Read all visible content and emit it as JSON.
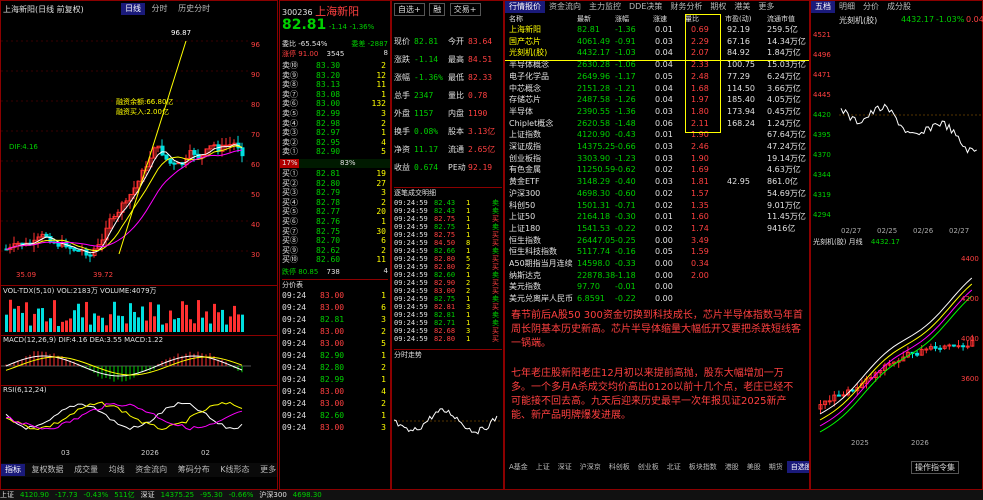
{
  "left_chart": {
    "title": "上海新阳(日线 前复权)",
    "tabs": [
      "日线",
      "分时",
      "历史分时"
    ],
    "price_axis": [
      "96",
      "90",
      "80",
      "70",
      "60",
      "50",
      "40",
      "30"
    ],
    "annotations": {
      "high": "96.87",
      "low1": "35.09",
      "low2": "39.72",
      "note1": "融资余额:66.80亿",
      "note2": "融资买入:2.00亿",
      "note3": "DIF:4.16"
    },
    "sub_titles": [
      "VOL-TDX(5,10) VOL:2183万 VOLUME:4079万",
      "MACD(12,26,9) DIF:4.16 DEA:3.55 MACD:1.22",
      "RSI(6,12,24)"
    ],
    "bottom_tabs": [
      "指标",
      "复权数据",
      "成交量",
      "均线",
      "资金流向",
      "筹码分布",
      "K线形态",
      "更多>>"
    ],
    "date_labels": [
      "03",
      "2026",
      "02"
    ]
  },
  "quote": {
    "code": "300236",
    "name": "上海新阳",
    "price": "82.81",
    "change": "-1.14",
    "pct": "-1.36%",
    "buttons": [
      "自选+",
      "融",
      "交易+"
    ],
    "header_row": [
      "委比 -65.54%",
      "委差 -2887"
    ],
    "sub_row": [
      "涨停",
      "91.00",
      "3545",
      "8"
    ],
    "sell_levels": [
      {
        "label": "卖⑩",
        "price": "83.30",
        "vol": "2"
      },
      {
        "label": "卖⑨",
        "price": "83.20",
        "vol": "12"
      },
      {
        "label": "卖⑧",
        "price": "83.13",
        "vol": "11"
      },
      {
        "label": "卖⑦",
        "price": "83.08",
        "vol": "1"
      },
      {
        "label": "卖⑥",
        "price": "83.00",
        "vol": "132"
      },
      {
        "label": "卖⑤",
        "price": "82.99",
        "vol": "3"
      },
      {
        "label": "卖④",
        "price": "82.98",
        "vol": "2"
      },
      {
        "label": "卖③",
        "price": "82.97",
        "vol": "1"
      },
      {
        "label": "卖②",
        "price": "82.95",
        "vol": "4"
      },
      {
        "label": "卖①",
        "price": "82.90",
        "vol": "5"
      }
    ],
    "buy_levels": [
      {
        "label": "买①",
        "price": "82.81",
        "vol": "19"
      },
      {
        "label": "买②",
        "price": "82.80",
        "vol": "27"
      },
      {
        "label": "买③",
        "price": "82.79",
        "vol": "3"
      },
      {
        "label": "买④",
        "price": "82.78",
        "vol": "2"
      },
      {
        "label": "买⑤",
        "price": "82.77",
        "vol": "20"
      },
      {
        "label": "买⑥",
        "price": "82.76",
        "vol": "1"
      },
      {
        "label": "买⑦",
        "price": "82.75",
        "vol": "30"
      },
      {
        "label": "买⑧",
        "price": "82.70",
        "vol": "6"
      },
      {
        "label": "买⑨",
        "price": "82.62",
        "vol": "2"
      },
      {
        "label": "买⑩",
        "price": "82.60",
        "vol": "11"
      }
    ],
    "ratio_bar": {
      "left": "17%",
      "right": "83%"
    },
    "low_row": [
      "跌停",
      "80.85",
      "738",
      "4"
    ],
    "stats": [
      [
        "现价",
        "82.81",
        "今开",
        "83.64"
      ],
      [
        "涨跌",
        "-1.14",
        "最高",
        "84.51"
      ],
      [
        "涨幅",
        "-1.36%",
        "最低",
        "82.33"
      ],
      [
        "总手",
        "2347",
        "量比",
        "0.78"
      ],
      [
        "外盘",
        "1157",
        "内盘",
        "1190"
      ],
      [
        "换手",
        "0.08%",
        "股本",
        "3.13亿"
      ],
      [
        "净资",
        "11.17",
        "流通",
        "2.65亿"
      ],
      [
        "收益",
        "0.674",
        "PE动",
        "92.19"
      ]
    ],
    "ticks_left": [
      [
        "09:24",
        "83.00",
        "1"
      ],
      [
        "09:24",
        "83.00",
        "6"
      ],
      [
        "09:24",
        "82.81",
        "3"
      ],
      [
        "09:24",
        "83.00",
        "2"
      ],
      [
        "09:24",
        "83.00",
        "5"
      ],
      [
        "09:24",
        "82.90",
        "1"
      ],
      [
        "09:24",
        "82.80",
        "2"
      ],
      [
        "09:24",
        "82.99",
        "1"
      ],
      [
        "09:24",
        "83.00",
        "4"
      ],
      [
        "09:24",
        "83.00",
        "2"
      ],
      [
        "09:24",
        "82.60",
        "1"
      ],
      [
        "09:24",
        "83.00",
        "3"
      ]
    ],
    "ticks_right_header": "逐笔成交明细",
    "ticks_right": [
      [
        "09:24:59",
        "82.43",
        "1",
        "卖"
      ],
      [
        "09:24:59",
        "82.43",
        "1",
        "卖"
      ],
      [
        "09:24:59",
        "82.75",
        "1",
        "买"
      ],
      [
        "09:24:59",
        "82.75",
        "1",
        "卖"
      ],
      [
        "09:24:59",
        "82.75",
        "1",
        "买"
      ],
      [
        "09:24:59",
        "84.50",
        "8",
        "买"
      ],
      [
        "09:24:59",
        "82.66",
        "1",
        "卖"
      ],
      [
        "09:24:59",
        "82.80",
        "5",
        "买"
      ],
      [
        "09:24:59",
        "82.80",
        "2",
        "买"
      ],
      [
        "09:24:59",
        "82.60",
        "1",
        "卖"
      ],
      [
        "09:24:59",
        "82.90",
        "2",
        "买"
      ],
      [
        "09:24:59",
        "83.00",
        "2",
        "买"
      ],
      [
        "09:24:59",
        "82.75",
        "1",
        "卖"
      ],
      [
        "09:24:59",
        "82.81",
        "3",
        "买"
      ],
      [
        "09:24:59",
        "82.81",
        "1",
        "卖"
      ],
      [
        "09:24:59",
        "82.71",
        "1",
        "卖"
      ],
      [
        "09:24:59",
        "82.68",
        "3",
        "买"
      ],
      [
        "09:24:59",
        "82.80",
        "1",
        "买"
      ]
    ],
    "mini_chart_label": "分时走势",
    "bottom_label": "分价表"
  },
  "watchlist": {
    "tabs": [
      "行情报价",
      "资金流向",
      "主力监控",
      "DDE决策",
      "财务分析",
      "期权",
      "港美",
      "更多"
    ],
    "columns": [
      "名称",
      "最新",
      "涨幅",
      "涨速",
      "量比",
      "市盈(动)",
      "流通市值"
    ],
    "rows": [
      {
        "name": "上海新阳",
        "price": "82.81",
        "chg": "-1.36",
        "speed": "0.01",
        "vr": "0.69",
        "pe": "92.19",
        "mcap": "259.5亿"
      },
      {
        "name": "国产芯片",
        "price": "4061.49",
        "chg": "-0.91",
        "speed": "0.03",
        "vr": "2.29",
        "pe": "67.16",
        "mcap": "14.34万亿"
      },
      {
        "name": "光刻机(胶)",
        "price": "4432.17",
        "chg": "-1.03",
        "speed": "0.04",
        "vr": "2.07",
        "pe": "84.92",
        "mcap": "1.84万亿"
      },
      {
        "name": "半导体概念",
        "price": "2630.28",
        "chg": "-1.06",
        "speed": "0.04",
        "vr": "2.33",
        "pe": "100.75",
        "mcap": "15.03万亿"
      },
      {
        "name": "电子化学品",
        "price": "2649.96",
        "chg": "-1.17",
        "speed": "0.05",
        "vr": "2.48",
        "pe": "77.29",
        "mcap": "6.24万亿"
      },
      {
        "name": "中芯概念",
        "price": "2151.28",
        "chg": "-1.21",
        "speed": "0.04",
        "vr": "1.68",
        "pe": "114.50",
        "mcap": "3.66万亿"
      },
      {
        "name": "存储芯片",
        "price": "2487.58",
        "chg": "-1.26",
        "speed": "0.04",
        "vr": "1.97",
        "pe": "185.40",
        "mcap": "4.05万亿"
      },
      {
        "name": "半导体",
        "price": "2390.55",
        "chg": "-1.36",
        "speed": "0.03",
        "vr": "1.80",
        "pe": "173.94",
        "mcap": "0.45万亿"
      },
      {
        "name": "Chiplet概念",
        "price": "2620.58",
        "chg": "-1.48",
        "speed": "0.06",
        "vr": "2.11",
        "pe": "168.24",
        "mcap": "1.24万亿"
      },
      {
        "name": "上证指数",
        "price": "4120.90",
        "chg": "-0.43",
        "speed": "0.01",
        "vr": "1.90",
        "pe": "",
        "mcap": "67.64万亿"
      },
      {
        "name": "深证成指",
        "price": "14375.25",
        "chg": "-0.66",
        "speed": "0.03",
        "vr": "2.46",
        "pe": "",
        "mcap": "47.24万亿"
      },
      {
        "name": "创业板指",
        "price": "3303.90",
        "chg": "-1.23",
        "speed": "0.03",
        "vr": "1.90",
        "pe": "",
        "mcap": "19.14万亿"
      },
      {
        "name": "有色金属",
        "price": "11250.59",
        "chg": "-0.62",
        "speed": "0.02",
        "vr": "1.69",
        "pe": "",
        "mcap": "4.63万亿"
      },
      {
        "name": "黄金ETF",
        "price": "3148.29",
        "chg": "-0.40",
        "speed": "0.03",
        "vr": "1.81",
        "pe": "42.95",
        "mcap": "861.0亿"
      },
      {
        "name": "沪深300",
        "price": "4698.30",
        "chg": "-0.60",
        "speed": "0.02",
        "vr": "1.57",
        "pe": "",
        "mcap": "54.69万亿"
      },
      {
        "name": "科创50",
        "price": "1501.31",
        "chg": "-0.71",
        "speed": "0.02",
        "vr": "1.35",
        "pe": "",
        "mcap": "9.01万亿"
      },
      {
        "name": "上证50",
        "price": "2164.18",
        "chg": "-0.30",
        "speed": "0.01",
        "vr": "1.60",
        "pe": "",
        "mcap": "11.45万亿"
      },
      {
        "name": "上证180",
        "price": "1541.53",
        "chg": "-0.22",
        "speed": "0.02",
        "vr": "1.74",
        "pe": "",
        "mcap": "9416亿"
      },
      {
        "name": "恒生指数",
        "price": "26447.05",
        "chg": "-0.25",
        "speed": "0.00",
        "vr": "3.49",
        "pe": "",
        "mcap": ""
      },
      {
        "name": "恒生科技指数",
        "price": "5117.74",
        "chg": "-0.16",
        "speed": "0.05",
        "vr": "1.59",
        "pe": "",
        "mcap": ""
      },
      {
        "name": "A50期指当月连续",
        "price": "14598.0",
        "chg": "-0.33",
        "speed": "0.00",
        "vr": "0.34",
        "pe": "",
        "mcap": ""
      },
      {
        "name": "纳斯达克",
        "price": "22878.38",
        "chg": "-1.18",
        "speed": "0.00",
        "vr": "2.00",
        "pe": "",
        "mcap": ""
      },
      {
        "name": "美元指数",
        "price": "97.70",
        "chg": "-0.01",
        "speed": "0.00",
        "vr": "",
        "pe": "",
        "mcap": ""
      },
      {
        "name": "美元兑离岸人民币",
        "price": "6.8591",
        "chg": "-0.22",
        "speed": "0.00",
        "vr": "",
        "pe": "",
        "mcap": ""
      }
    ],
    "note1": "春节前后A股50 300资金切换到科技成长，芯片半导体指数马年首周长阴基本历史新高。芯片半导体缩量大幅低开又要把杀跌短线客一锅端。",
    "note2": "七年老庄股新阳老庄12月初以来提前高抛，股东大幅增加一万多。一个多月A杀成交均价高出0120以前十几个点，老庄已经不可能接不回去高。九天后迎来历史最早一次年报见证2025新产能、新产品明牌爆发进展。",
    "bottom_tabs": [
      "A基金",
      "上证",
      "深证",
      "沪深京",
      "科创板",
      "创业板",
      "北证",
      "板块指数",
      "港股",
      "美股",
      "期货",
      "自选股",
      "市场",
      "东方财富",
      "更多"
    ]
  },
  "right_panel": {
    "title": "光刻机(胶)",
    "price": "4432.17",
    "pct": "-1.03%",
    "pct2": "0.04%",
    "tabs": [
      "五档",
      "明细",
      "分价",
      "成分股"
    ],
    "mini_label": "光刻机(胶)  月线",
    "mini_price": "4432.17",
    "date_labels": [
      "02/27",
      "02/25",
      "02/26",
      "02/27"
    ],
    "k_prices": [
      "4400",
      "4200",
      "4000",
      "3600"
    ],
    "k_date": [
      "2025",
      "2026"
    ],
    "bottom_btn": "操作指令集"
  },
  "status_bar": {
    "items": [
      "上证",
      "4120.90",
      "-17.73",
      "-0.43%",
      "511亿",
      "深证",
      "14375.25",
      "-95.30",
      "-0.66%",
      "沪深300",
      "4698.30"
    ]
  }
}
